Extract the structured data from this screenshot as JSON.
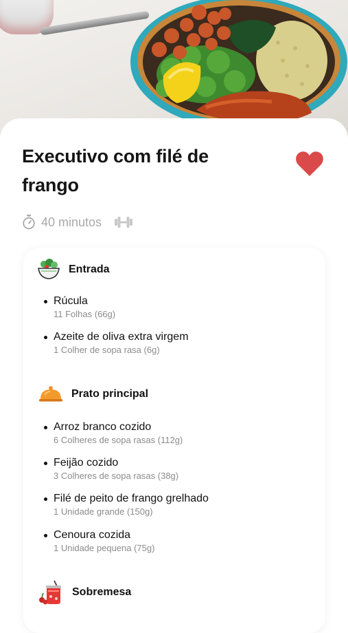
{
  "recipe": {
    "title": "Executivo com filé de frango",
    "time": "40 minutos"
  },
  "icons": {
    "favorite": "heart-icon",
    "timer": "stopwatch-icon",
    "difficulty": "dumbbell-icon",
    "entrada": "salad-bowl-icon",
    "prato": "cloche-icon",
    "sobremesa": "fruit-jar-icon"
  },
  "colors": {
    "favorite": "#db4a4a",
    "meta": "#a9a9a9",
    "quantity": "#8b8b8b",
    "bowl_rim": "#3bb4c6",
    "cloche": "#ef8a1f"
  },
  "sections": [
    {
      "title": "Entrada",
      "items": [
        {
          "name": "Rúcula",
          "qty": "11 Folhas (66g)"
        },
        {
          "name": "Azeite de oliva extra virgem",
          "qty": "1 Colher de sopa rasa (6g)"
        }
      ]
    },
    {
      "title": "Prato principal",
      "items": [
        {
          "name": "Arroz branco cozido",
          "qty": "6 Colheres de sopa rasas (112g)"
        },
        {
          "name": "Feijão cozido",
          "qty": "3 Colheres de sopa rasas (38g)"
        },
        {
          "name": "Filé de peito de frango grelhado",
          "qty": "1 Unidade grande (150g)"
        },
        {
          "name": "Cenoura cozida",
          "qty": "1 Unidade pequena (75g)"
        }
      ]
    },
    {
      "title": "Sobremesa",
      "items": []
    }
  ]
}
